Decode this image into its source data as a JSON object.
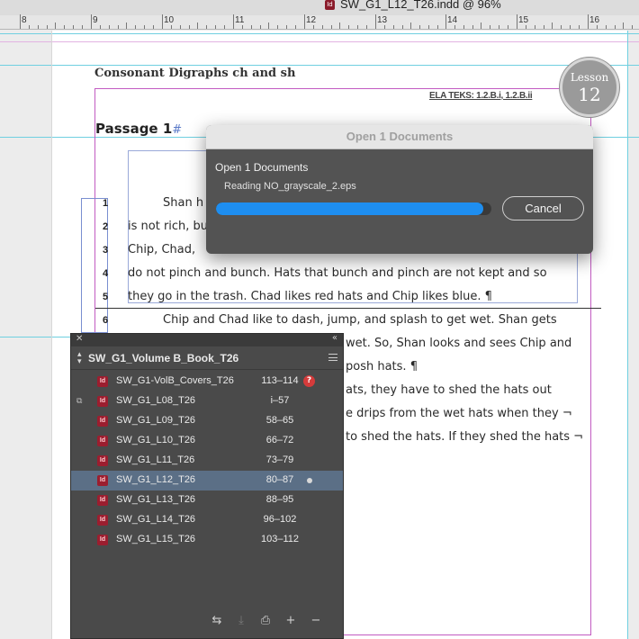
{
  "window": {
    "title": "SW_G1_L12_T26.indd @ 96%",
    "doc_icon": "indesign-doc-icon",
    "doc_icon_label": "Id"
  },
  "ruler": {
    "labels": [
      "8",
      "9",
      "10",
      "11",
      "12",
      "13",
      "14",
      "15",
      "16"
    ]
  },
  "document": {
    "header_title": "Consonant Digraphs ch and sh",
    "teks": "ELA TEKS: 1.2.B.i, 1.2.B.ii",
    "lesson_label": "Lesson",
    "lesson_number": "12",
    "passage_title": "Passage 1",
    "passage_marker": "#",
    "lines": [
      {
        "num": "1",
        "text": "Shan h"
      },
      {
        "num": "2",
        "text": "is not rich, bu"
      },
      {
        "num": "3",
        "text": "Chip, Chad,"
      },
      {
        "num": "4",
        "text": "do not pinch and bunch. Hats that bunch and pinch are not kept and so"
      },
      {
        "num": "5",
        "text": "they go in the trash. Chad likes red hats and Chip likes blue. ¶"
      },
      {
        "num": "6",
        "text": "Chip and Chad like to dash, jump, and splash to get wet. Shan gets"
      },
      {
        "num": "",
        "text": "wet. So, Shan looks and sees Chip and"
      },
      {
        "num": "",
        "text": "posh hats. ¶"
      },
      {
        "num": "",
        "text": "ats, they have to shed the hats out"
      },
      {
        "num": "",
        "text": "e drips from the wet hats when they ¬"
      },
      {
        "num": "",
        "text": "to shed the hats. If they shed the hats ¬"
      }
    ]
  },
  "dialog": {
    "title": "Open 1 Documents",
    "heading": "Open 1 Documents",
    "status": "Reading NO_grayscale_2.eps",
    "progress": 0.97,
    "cancel_label": "Cancel"
  },
  "book_panel": {
    "title": "SW_G1_Volume B_Book_T26",
    "rows": [
      {
        "name": "SW_G1-VolB_Covers_T26",
        "pages": "113–114",
        "status": "missing",
        "selected": false,
        "sync": false
      },
      {
        "name": "SW_G1_L08_T26",
        "pages": "i–57",
        "status": "",
        "selected": false,
        "sync": true
      },
      {
        "name": "SW_G1_L09_T26",
        "pages": "58–65",
        "status": "",
        "selected": false,
        "sync": false
      },
      {
        "name": "SW_G1_L10_T26",
        "pages": "66–72",
        "status": "",
        "selected": false,
        "sync": false
      },
      {
        "name": "SW_G1_L11_T26",
        "pages": "73–79",
        "status": "",
        "selected": false,
        "sync": false
      },
      {
        "name": "SW_G1_L12_T26",
        "pages": "80–87",
        "status": "open",
        "selected": true,
        "sync": false
      },
      {
        "name": "SW_G1_L13_T26",
        "pages": "88–95",
        "status": "",
        "selected": false,
        "sync": false
      },
      {
        "name": "SW_G1_L14_T26",
        "pages": "96–102",
        "status": "",
        "selected": false,
        "sync": false
      },
      {
        "name": "SW_G1_L15_T26",
        "pages": "103–112",
        "status": "",
        "selected": false,
        "sync": false
      }
    ],
    "missing_glyph": "?",
    "footer_icons": [
      "synchronize-icon",
      "save-book-icon",
      "print-book-icon",
      "add-document-icon",
      "remove-document-icon"
    ]
  },
  "colors": {
    "accent": "#1e8ef0",
    "selected_row": "#5b6f86",
    "indesign_red": "#9b1e2f",
    "guide": "#6fd0e0",
    "margin": "#c25bc2"
  }
}
